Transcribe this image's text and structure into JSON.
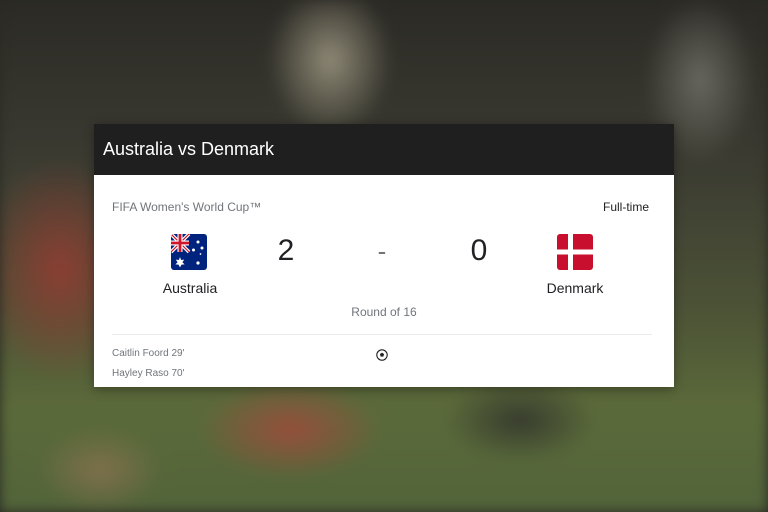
{
  "card": {
    "title": "Australia vs Denmark",
    "competition": "FIFA Women's World Cup™",
    "status": "Full-time",
    "round": "Round of 16",
    "separator": "-"
  },
  "home": {
    "name": "Australia",
    "score": "2",
    "flag_icon": "australia-flag-icon",
    "scorers": [
      "Caitlin Foord 29'",
      "Hayley Raso 70'"
    ]
  },
  "away": {
    "name": "Denmark",
    "score": "0",
    "flag_icon": "denmark-flag-icon"
  },
  "colors": {
    "header_bg": "#1f1f1f",
    "text_primary": "#202124",
    "text_secondary": "#70757a",
    "dk_red": "#c8102e",
    "au_blue": "#00247d"
  }
}
